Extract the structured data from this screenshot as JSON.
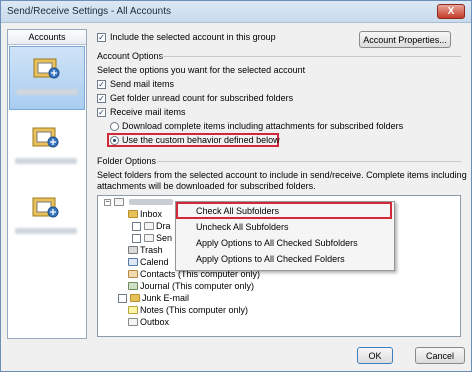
{
  "window": {
    "title": "Send/Receive Settings - All Accounts",
    "close_label": "X"
  },
  "accounts": {
    "header": "Accounts"
  },
  "top": {
    "include_label": "Include the selected account in this group",
    "account_properties_label": "Account Properties..."
  },
  "account_options": {
    "heading": "Account Options",
    "instruction": "Select the options you want for the selected account",
    "send_mail": "Send mail items",
    "get_unread": "Get folder unread count for subscribed folders",
    "receive_mail": "Receive mail items",
    "download_complete": "Download complete items including attachments for subscribed folders",
    "custom_behavior": "Use the custom behavior defined below"
  },
  "folder_options": {
    "heading": "Folder Options",
    "description_1": "Select folders from the selected account to include in send/receive. Complete items including",
    "description_2": "attachments will be downloaded for subscribed folders."
  },
  "tree": {
    "inbox": "Inbox",
    "drafts": "Dra",
    "sent": "Sen",
    "trash": "Trash",
    "calendar": "Calend",
    "contacts": "Contacts (This computer only)",
    "journal": "Journal (This computer only)",
    "junk": "Junk E-mail",
    "notes": "Notes (This computer only)",
    "outbox": "Outbox"
  },
  "context_menu": {
    "check_all": "Check All Subfolders",
    "uncheck_all": "Uncheck All Subfolders",
    "apply_checked_sub": "Apply Options to All Checked Subfolders",
    "apply_checked": "Apply Options to All Checked Folders"
  },
  "footer": {
    "ok": "OK",
    "cancel": "Cancel"
  },
  "colors": {
    "highlight": "#d1283a",
    "selection": "#a9cdf0"
  },
  "icons": [
    "account-icon",
    "folder-icon",
    "close-icon"
  ]
}
